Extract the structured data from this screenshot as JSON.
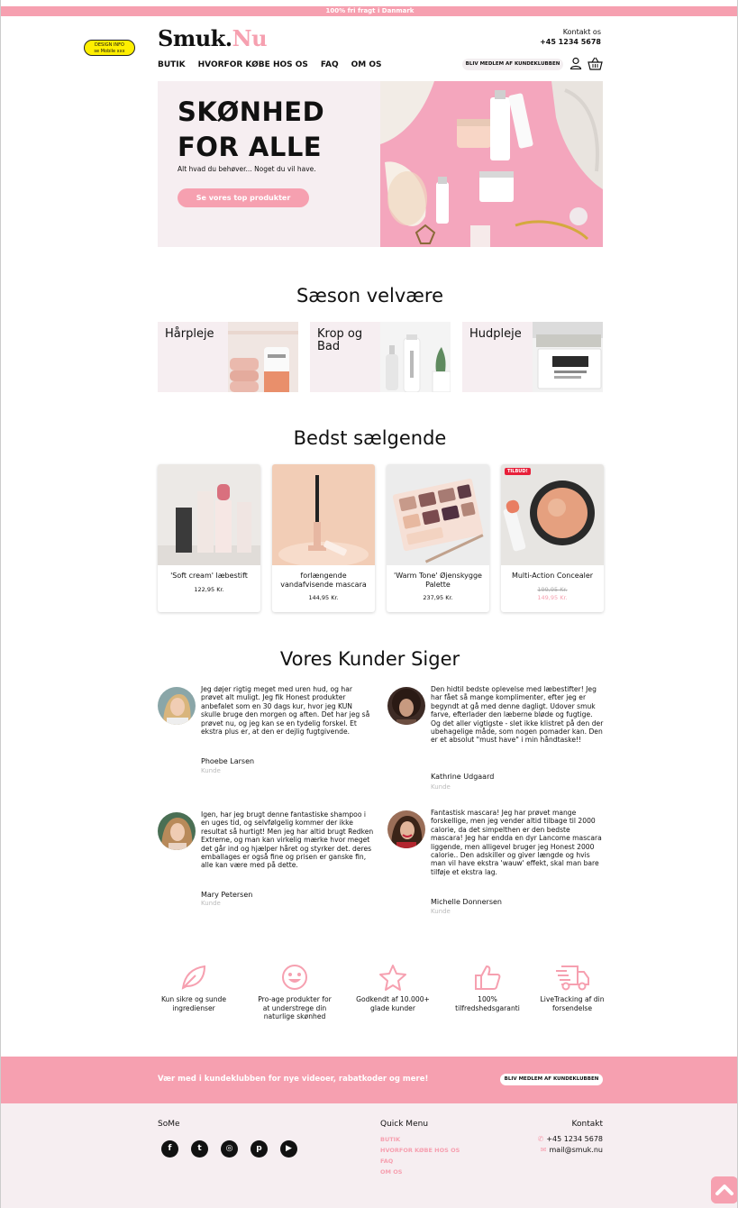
{
  "topbar": {
    "text": "100% fri fragt i Danmark"
  },
  "design_badge": {
    "line1": "DESIGN INFO",
    "line2": "se Mobile xxx"
  },
  "brand": {
    "name_a": "Smuk.",
    "name_b": "Nu",
    "accent_color": "#f6a0b0"
  },
  "header_contact": {
    "label": "Kontakt os",
    "phone": "+45 1234 5678"
  },
  "nav": {
    "items": [
      "BUTIK",
      "HVORFOR KØBE HOS OS",
      "FAQ",
      "OM OS"
    ],
    "join_label": "BLIV MEDLEM AF KUNDEKLUBBEN"
  },
  "icons": {
    "user": "user-icon",
    "basket": "basket-icon"
  },
  "hero": {
    "title_line1": "SKØNHED",
    "title_line2": "FOR ALLE",
    "subtitle": "Alt hvad du behøver... Noget du vil have.",
    "button_label": "Se vores top produkter"
  },
  "season": {
    "title": "Sæson velvære",
    "categories": [
      {
        "label": "Hårpleje"
      },
      {
        "label": "Krop og Bad"
      },
      {
        "label": "Hudpleje"
      }
    ]
  },
  "bestsellers": {
    "title": "Bedst sælgende",
    "products": [
      {
        "name": "'Soft cream' læbestift",
        "price": "122,95 Kr."
      },
      {
        "name": "forlængende vandafvisende mascara",
        "price": "144,95 Kr."
      },
      {
        "name": "'Warm Tone' Øjenskygge Palette",
        "price": "237,95 Kr."
      },
      {
        "name": "Multi-Action Concealer",
        "old_price": "199,95 Kr.",
        "price": "149,95 Kr.",
        "badge": "TILBUD!"
      }
    ]
  },
  "reviews": {
    "title": "Vores Kunder Siger",
    "items": [
      {
        "text": "Jeg døjer rigtig meget med uren hud, og har prøvet alt muligt. Jeg fik Honest produkter anbefalet som en 30 dags kur, hvor jeg KUN skulle bruge den morgen og aften. Det har jeg så prøvet nu, og jeg kan se en tydelig forskel. Et ekstra plus er, at den er dejlig fugtgivende.",
        "name": "Phoebe Larsen",
        "role": "Kunde"
      },
      {
        "text": "Den hidtil bedste oplevelse med læbestifter! Jeg har fået så mange komplimenter, efter jeg er begyndt at gå med denne dagligt. Udover smuk farve, efterlader den læberne bløde og fugtige. Og det aller vigtigste - slet ikke klistret på den der ubehagelige måde, som nogen pomader kan. Den er et absolut \"must have\" i min håndtaske!!",
        "name": "Kathrine Udgaard",
        "role": "Kunde"
      },
      {
        "text": "Igen, har jeg brugt denne fantastiske shampoo i en uges tid, og selvfølgelig kommer der ikke resultat så hurtigt! Men jeg har altid brugt Redken Extreme, og man kan virkelig mærke hvor meget det går ind og hjælper håret og styrker det. deres emballages er også fine og prisen er ganske fin, alle kan være med på dette.",
        "name": "Mary Petersen",
        "role": "Kunde"
      },
      {
        "text": "Fantastisk mascara! Jeg har prøvet mange forskellige, men jeg vender altid tilbage til 2000 calorie, da det simpelthen er den bedste mascara! Jeg har endda en dyr Lancome mascara liggende, men alligevel bruger jeg Honest 2000 calorie.. Den adskiller og giver længde og hvis man vil have ekstra 'wauw' effekt, skal man bare tilføje et ekstra lag.",
        "name": "Michelle Donnersen",
        "role": "Kunde"
      }
    ]
  },
  "usps": [
    {
      "icon": "leaf-icon",
      "text": "Kun sikre og sunde ingredienser"
    },
    {
      "icon": "smiley-icon",
      "text": "Pro-age produkter for at understrege din naturlige skønhed"
    },
    {
      "icon": "star-icon",
      "text": "Godkendt af 10.000+ glade kunder"
    },
    {
      "icon": "thumbs-up-icon",
      "text": "100% tilfredshedsgaranti"
    },
    {
      "icon": "truck-icon",
      "text": "LiveTracking af din forsendelse"
    }
  ],
  "join_band": {
    "text": "Vær med i kundeklubben for nye videoer, rabatkoder og mere!",
    "button_label": "BLIV MEDLEM AF KUNDEKLUBBEN"
  },
  "footer": {
    "some_title": "SoMe",
    "social": [
      "f",
      "t",
      "◎",
      "p",
      "▶"
    ],
    "quick_title": "Quick Menu",
    "quick_items": [
      "BUTIK",
      "HVORFOR KØBE HOS OS",
      "FAQ",
      "OM OS"
    ],
    "contact_title": "Kontakt",
    "phone": "+45 1234 5678",
    "email": "mail@smuk.nu"
  }
}
